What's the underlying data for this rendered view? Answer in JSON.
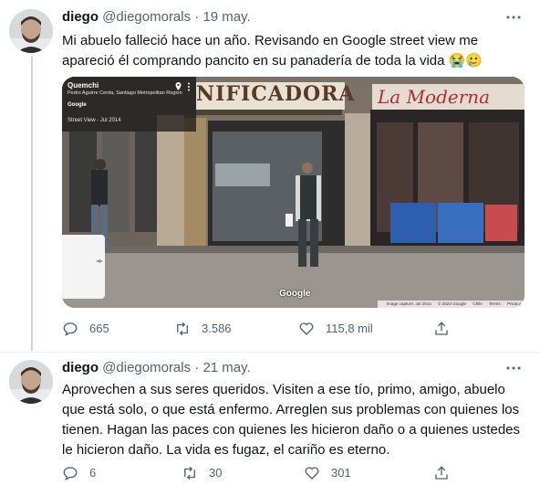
{
  "tweets": [
    {
      "name": "diego",
      "handle": "@diegomorals",
      "separator": "·",
      "date": "19 may.",
      "text": "Mi abuelo falleció hace un año. Revisando en Google street view me apareció él comprando pancito en su panadería de toda la vida",
      "emojis": "😭🥲",
      "media": {
        "street_view": {
          "title": "Quemchi",
          "address": "Pedro Aguirre Cerda, Santiago Metropolitan Region",
          "brand": "Google",
          "capture": "Street View - Jul 2014",
          "watermark": "Google",
          "credits": [
            "Image capture: Jul 2014",
            "© 2022 Google",
            "Chile",
            "Terms",
            "Privacy"
          ],
          "sign_left": "NIFICADORA",
          "sign_right": "La Moderna"
        }
      },
      "actions": {
        "reply": "665",
        "retweet": "3.586",
        "like": "115,8 mil",
        "share": ""
      }
    },
    {
      "name": "diego",
      "handle": "@diegomorals",
      "separator": "·",
      "date": "21 may.",
      "text": "Aprovechen a sus seres queridos. Visiten a ese tío, primo, amigo, abuelo que está solo, o que está enfermo. Arreglen sus problemas con quienes los tienen. Hagan las paces con quienes les hicieron daño o a quienes ustedes le hicieron daño. La vida es fugaz, el cariño es eterno.",
      "actions": {
        "reply": "6",
        "retweet": "30",
        "like": "301",
        "share": ""
      }
    }
  ],
  "icons": {
    "reply": "comment-bubble-icon",
    "retweet": "retweet-arrows-icon",
    "like": "heart-outline-icon",
    "share": "share-upload-icon",
    "more": "more-dots-icon"
  },
  "colors": {
    "text_primary": "#0f1419",
    "text_secondary": "#536471",
    "thread_line": "#cfd9de",
    "divider": "#eff3f4"
  }
}
